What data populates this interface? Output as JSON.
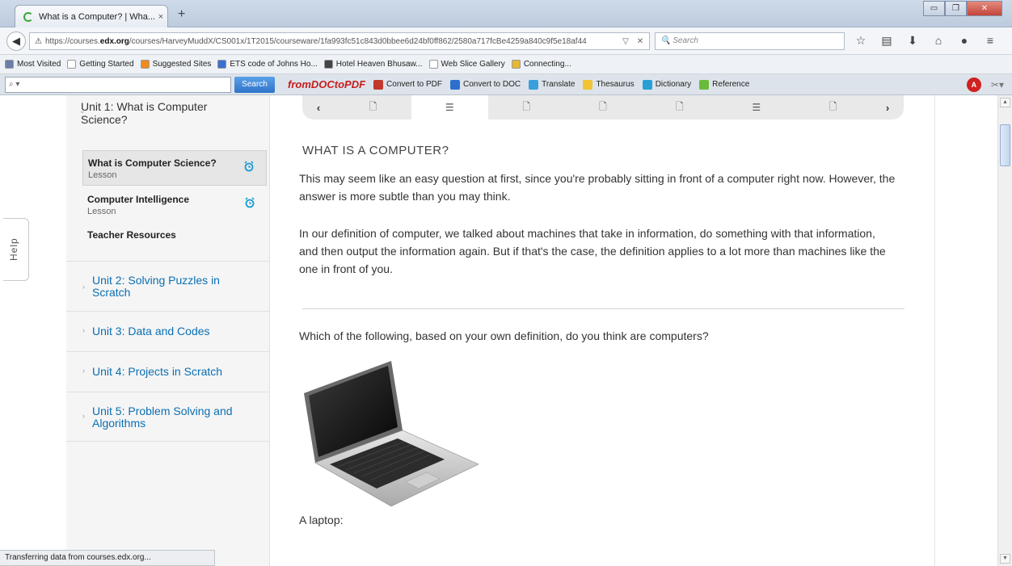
{
  "browser": {
    "tab_title": "What is a Computer? | Wha...",
    "tab_close": "×",
    "new_tab": "+",
    "window_buttons": [
      "▭",
      "❐",
      "✕"
    ],
    "url_prefix": "https://courses.",
    "url_domain": "edx.org",
    "url_rest": "/courses/HarveyMuddX/CS001x/1T2015/courseware/1fa993fc51c843d0bbee6d24bf0ff862/2580a717fcBe4259a840c9f5e18af44",
    "search_placeholder": "Search",
    "bookmarks": [
      {
        "label": "Most Visited",
        "color": "#6a7fa8"
      },
      {
        "label": "Getting Started",
        "color": "#ffffff"
      },
      {
        "label": "Suggested Sites",
        "color": "#f28b1e"
      },
      {
        "label": "ETS code of Johns Ho...",
        "color": "#3a6fd0"
      },
      {
        "label": "Hotel Heaven Bhusaw...",
        "color": "#444444"
      },
      {
        "label": "Web Slice Gallery",
        "color": "#ffffff"
      },
      {
        "label": "Connecting...",
        "color": "#e8b830"
      }
    ],
    "toolbar_search_button": "Search",
    "toolbar_logo": "fromDOCtoPDF",
    "toolbar_items": [
      {
        "label": "Convert to PDF",
        "color": "#c0392b"
      },
      {
        "label": "Convert to DOC",
        "color": "#2e6fce"
      },
      {
        "label": "Translate",
        "color": "#3aa0dd"
      },
      {
        "label": "Thesaurus",
        "color": "#f2c335"
      },
      {
        "label": "Dictionary",
        "color": "#2a9fd6"
      },
      {
        "label": "Reference",
        "color": "#6aba3a"
      }
    ],
    "status_text": "Transferring data from courses.edx.org..."
  },
  "help_label": "Help",
  "sidebar": {
    "unit1_title": "Unit 1: What is Computer Science?",
    "lessons": [
      {
        "title": "What is Computer Science?",
        "subtitle": "Lesson"
      },
      {
        "title": "Computer Intelligence",
        "subtitle": "Lesson"
      }
    ],
    "teacher_resources": "Teacher Resources",
    "units": [
      "Unit 2: Solving Puzzles in Scratch",
      "Unit 3: Data and Codes",
      "Unit 4: Projects in Scratch",
      "Unit 5: Problem Solving and Algorithms"
    ]
  },
  "content": {
    "sequence_nav": {
      "prev": "‹",
      "next": "›",
      "items": [
        "document-icon",
        "list-icon",
        "document-icon",
        "document-icon",
        "document-icon",
        "list-icon",
        "document-icon"
      ],
      "active_index": 1
    },
    "heading": "WHAT IS A COMPUTER?",
    "para1": "This may seem like an easy question at first, since you're probably sitting in front of a computer right now. However, the answer is more subtle than you may think.",
    "para2": "In our definition of computer, we talked about machines that take in information, do something with that information, and then output the information again. But if that's the case, the definition applies to a lot more than machines like the one in front of you.",
    "question": "Which of the following, based on your own definition, do you think are computers?",
    "caption": "A laptop:"
  }
}
